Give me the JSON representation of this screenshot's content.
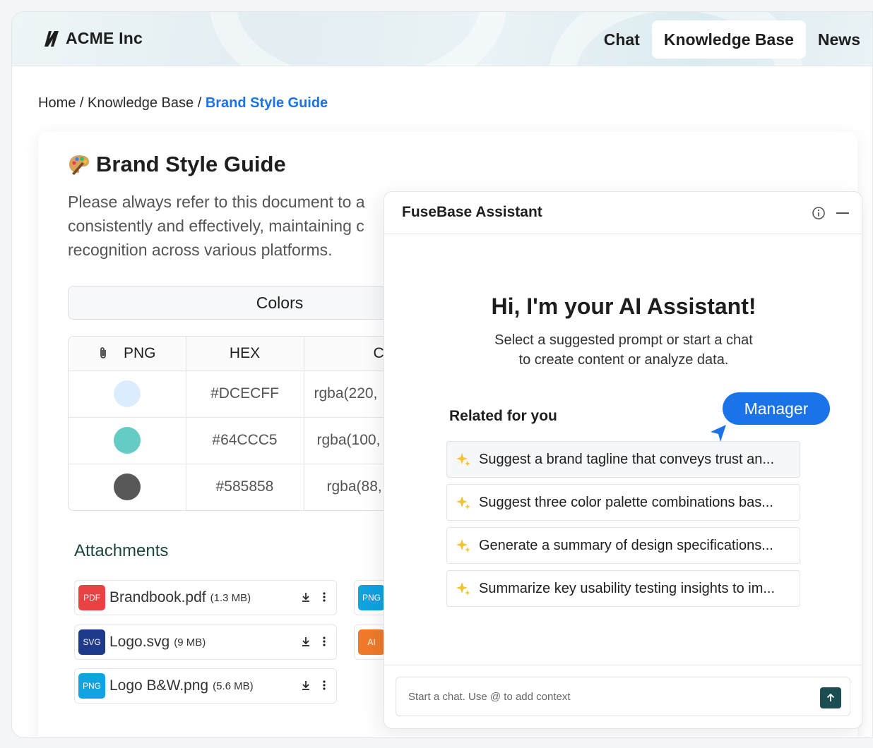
{
  "header": {
    "brand": "ACME Inc",
    "nav": [
      {
        "label": "Chat"
      },
      {
        "label": "Knowledge Base"
      },
      {
        "label": "News"
      }
    ]
  },
  "breadcrumb": {
    "home": "Home",
    "sep": " / ",
    "section": "Knowledge Base",
    "current": "Brand Style Guide"
  },
  "document": {
    "title": "Brand Style Guide",
    "desc_line1": "Please always refer to this document to a",
    "desc_line2": "consistently and effectively, maintaining c",
    "desc_line3": "recognition across various platforms.",
    "colors_label": "Colors",
    "table": {
      "headers": [
        "PNG",
        "HEX",
        "C"
      ],
      "rows": [
        {
          "swatch": "#DCECFF",
          "hex": "#DCECFF",
          "rgba": "rgba(220,"
        },
        {
          "swatch": "#64CCC5",
          "hex": "#64CCC5",
          "rgba": "rgba(100,"
        },
        {
          "swatch": "#585858",
          "hex": "#585858",
          "rgba": "rgba(88,"
        }
      ]
    }
  },
  "attachments": {
    "title": "Attachments",
    "files": [
      {
        "type": "PDF",
        "name": "Brandbook.pdf",
        "size": "(1.3 MB)",
        "color": "#e84242"
      },
      {
        "type": "SVG",
        "name": "Logo.svg",
        "size": "(9 MB)",
        "color": "#1f3a8a"
      },
      {
        "type": "PNG",
        "name": "Logo B&W.png",
        "size": "(5.6 MB)",
        "color": "#0fa3e0"
      }
    ],
    "partial": [
      {
        "type": "PNG",
        "color": "#0fa3e0"
      },
      {
        "type": "AI",
        "color": "#f07a2a"
      }
    ]
  },
  "assistant": {
    "title": "FuseBase Assistant",
    "greeting": "Hi, I'm your AI Assistant!",
    "sub1": "Select a suggested prompt or start a chat",
    "sub2": "to create content or analyze data.",
    "related_label": "Related for you",
    "manager_tag": "Manager",
    "prompts": [
      "Suggest a brand tagline that conveys trust an...",
      "Suggest three color palette combinations bas...",
      "Generate a summary of design specifications...",
      "Summarize key usability testing insights to im..."
    ],
    "input_placeholder": "Start a chat. Use @ to add context"
  },
  "colors": {
    "accent": "#1a73e8",
    "send": "#1b4d52",
    "sparkle": "#f4c430"
  }
}
